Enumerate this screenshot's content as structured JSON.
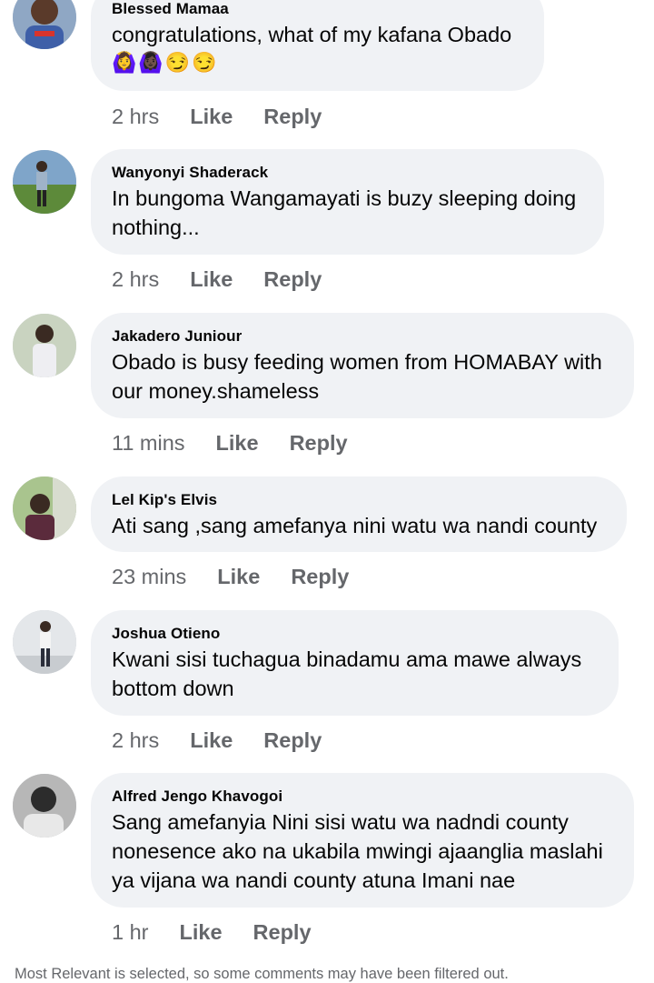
{
  "labels": {
    "like": "Like",
    "reply": "Reply"
  },
  "comments": [
    {
      "author": "Blessed Mamaa",
      "text": "congratulations, what of my kafana Obado",
      "emojis": "🙆‍♀️🙆🏿‍♀️😏😏",
      "time": "2 hrs"
    },
    {
      "author": "Wanyonyi Shaderack",
      "text": "In bungoma Wangamayati is buzy sleeping doing nothing...",
      "time": "2 hrs"
    },
    {
      "author": "Jakadero Juniour",
      "text": "Obado is busy feeding women from HOMABAY with our money.shameless",
      "time": "11 mins"
    },
    {
      "author": "Lel Kip's Elvis",
      "text": "Ati sang ,sang amefanya nini watu wa nandi county",
      "time": "23 mins"
    },
    {
      "author": "Joshua Otieno",
      "text": "Kwani sisi tuchagua binadamu ama mawe always bottom down",
      "time": "2 hrs"
    },
    {
      "author": "Alfred Jengo Khavogoi",
      "text": "Sang amefanyia Nini sisi watu wa nadndi county nonesence ako na ukabila mwingi ajaanglia maslahi ya vijana wa nandi county atuna Imani nae",
      "time": "1 hr"
    }
  ],
  "footer": {
    "filter_notice": "Most Relevant is selected, so some comments may have been filtered out."
  },
  "colors": {
    "bubble": "#f0f2f5",
    "meta_text": "#65676b",
    "primary_text": "#050505"
  }
}
